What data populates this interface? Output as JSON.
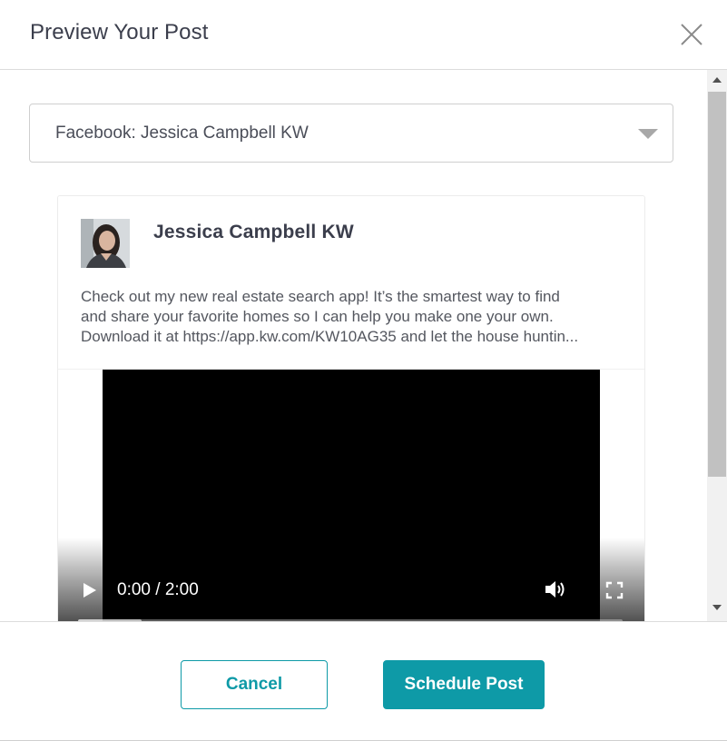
{
  "modal": {
    "title": "Preview Your Post",
    "close_icon": "close-icon"
  },
  "account_select": {
    "selected": "Facebook: Jessica Campbell KW",
    "caret_icon": "chevron-down-icon"
  },
  "post": {
    "author": "Jessica Campbell KW",
    "avatar_icon": "avatar-photo",
    "text_lines": [
      "Check out my new real estate search app! It’s the smartest way to find",
      "and share your favorite homes so I can help you make one your own.",
      "Download it at https://app.kw.com/KW10AG35 and let the house huntin..."
    ]
  },
  "video": {
    "time": "0:00 / 2:00",
    "play_icon": "play-icon",
    "volume_icon": "volume-icon",
    "fullscreen_icon": "fullscreen-icon",
    "progress": 0
  },
  "footer": {
    "cancel_label": "Cancel",
    "schedule_label": "Schedule Post"
  },
  "colors": {
    "accent": "#0e9aa7",
    "title_text": "#3b3e4c",
    "body_text": "#54575f"
  }
}
